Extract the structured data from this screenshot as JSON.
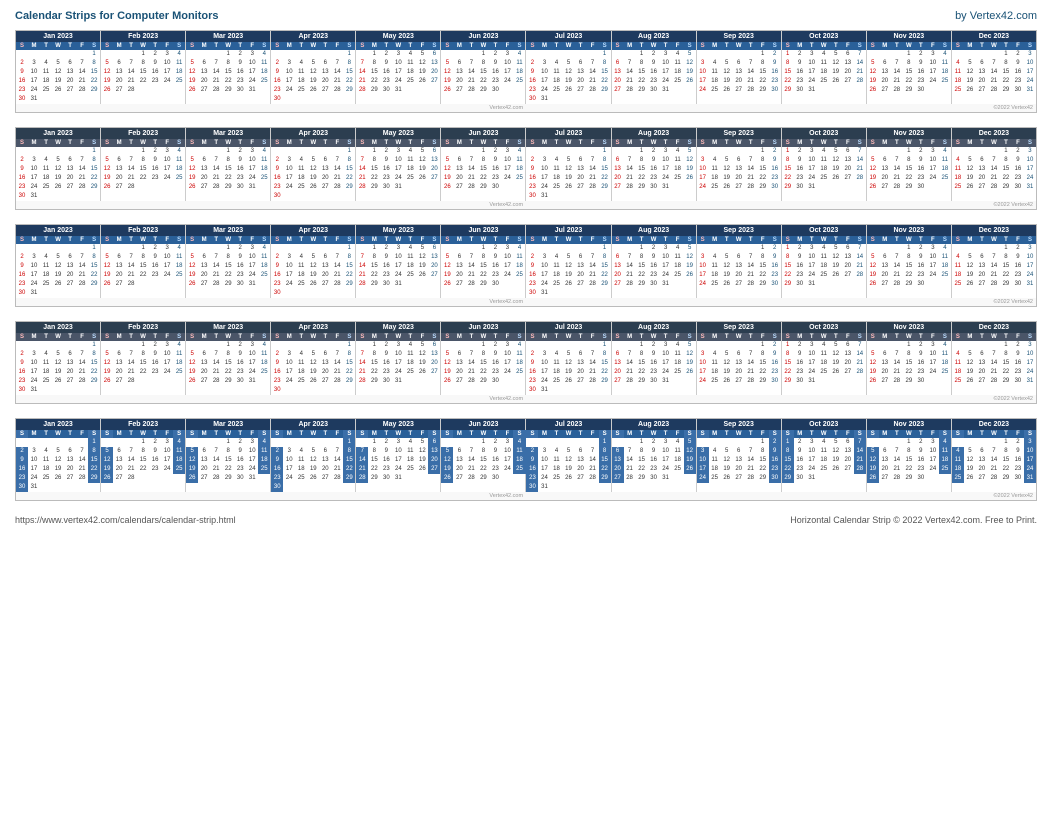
{
  "header": {
    "title": "Calendar Strips for Computer Monitors",
    "brand": "by Vertex42.com"
  },
  "footer": {
    "url": "https://www.vertex42.com/calendars/calendar-strip.html",
    "copyright": "Horizontal Calendar Strip © 2022 Vertex42.com. Free to Print."
  },
  "year": "2023",
  "months": [
    {
      "name": "Jan 2023",
      "weeks": [
        [
          "",
          "",
          "",
          "",
          "",
          "",
          "1"
        ],
        [
          "2",
          "3",
          "4",
          "5",
          "6",
          "7",
          "8"
        ],
        [
          "9",
          "10",
          "11",
          "12",
          "13",
          "14",
          "15"
        ],
        [
          "16",
          "17",
          "18",
          "19",
          "20",
          "21",
          "22"
        ],
        [
          "23",
          "24",
          "25",
          "26",
          "27",
          "28",
          "29"
        ],
        [
          "30",
          "31",
          "",
          "",
          "",
          "",
          ""
        ]
      ]
    },
    {
      "name": "Feb 2023",
      "weeks": [
        [
          "",
          "",
          "",
          "1",
          "2",
          "3",
          "4"
        ],
        [
          "5",
          "6",
          "7",
          "8",
          "9",
          "10",
          "11"
        ],
        [
          "12",
          "13",
          "14",
          "15",
          "16",
          "17",
          "18"
        ],
        [
          "19",
          "20",
          "21",
          "22",
          "23",
          "24",
          "25"
        ],
        [
          "26",
          "27",
          "28",
          "",
          "",
          "",
          ""
        ],
        [
          "",
          "",
          "",
          "",
          "",
          "",
          ""
        ]
      ]
    },
    {
      "name": "Mar 2023",
      "weeks": [
        [
          "",
          "",
          "",
          "1",
          "2",
          "3",
          "4"
        ],
        [
          "5",
          "6",
          "7",
          "8",
          "9",
          "10",
          "11"
        ],
        [
          "12",
          "13",
          "14",
          "15",
          "16",
          "17",
          "18"
        ],
        [
          "19",
          "20",
          "21",
          "22",
          "23",
          "24",
          "25"
        ],
        [
          "26",
          "27",
          "28",
          "29",
          "30",
          "31",
          ""
        ],
        [
          "",
          "",
          "",
          "",
          "",
          "",
          ""
        ]
      ]
    },
    {
      "name": "Apr 2023",
      "weeks": [
        [
          "",
          "",
          "",
          "",
          "",
          "",
          "1"
        ],
        [
          "2",
          "3",
          "4",
          "5",
          "6",
          "7",
          "8"
        ],
        [
          "9",
          "10",
          "11",
          "12",
          "13",
          "14",
          "15"
        ],
        [
          "16",
          "17",
          "18",
          "19",
          "20",
          "21",
          "22"
        ],
        [
          "23",
          "24",
          "25",
          "26",
          "27",
          "28",
          "29"
        ],
        [
          "30",
          "",
          "",
          "",
          "",
          "",
          ""
        ]
      ]
    },
    {
      "name": "May 2023",
      "weeks": [
        [
          "",
          "1",
          "2",
          "3",
          "4",
          "5",
          "6"
        ],
        [
          "7",
          "8",
          "9",
          "10",
          "11",
          "12",
          "13"
        ],
        [
          "14",
          "15",
          "16",
          "17",
          "18",
          "19",
          "20"
        ],
        [
          "21",
          "22",
          "23",
          "24",
          "25",
          "26",
          "27"
        ],
        [
          "28",
          "29",
          "30",
          "31",
          "",
          "",
          ""
        ],
        [
          "",
          "",
          "",
          "",
          "",
          "",
          ""
        ]
      ]
    },
    {
      "name": "Jun 2023",
      "weeks": [
        [
          "",
          "",
          "",
          "1",
          "2",
          "3",
          "4"
        ],
        [
          "5",
          "6",
          "7",
          "8",
          "9",
          "10",
          "11"
        ],
        [
          "12",
          "13",
          "14",
          "15",
          "16",
          "17",
          "18"
        ],
        [
          "19",
          "20",
          "21",
          "22",
          "23",
          "24",
          "25"
        ],
        [
          "26",
          "27",
          "28",
          "29",
          "30",
          "",
          ""
        ],
        [
          "",
          "",
          "",
          "",
          "",
          "",
          ""
        ]
      ]
    },
    {
      "name": "Jul 2023",
      "weeks": [
        [
          "",
          "",
          "",
          "",
          "",
          "",
          "1"
        ],
        [
          "2",
          "3",
          "4",
          "5",
          "6",
          "7",
          "8"
        ],
        [
          "9",
          "10",
          "11",
          "12",
          "13",
          "14",
          "15"
        ],
        [
          "16",
          "17",
          "18",
          "19",
          "20",
          "21",
          "22"
        ],
        [
          "23",
          "24",
          "25",
          "26",
          "27",
          "28",
          "29"
        ],
        [
          "30",
          "31",
          "",
          "",
          "",
          "",
          ""
        ]
      ]
    },
    {
      "name": "Aug 2023",
      "weeks": [
        [
          "",
          "",
          "1",
          "2",
          "3",
          "4",
          "5"
        ],
        [
          "6",
          "7",
          "8",
          "9",
          "10",
          "11",
          "12"
        ],
        [
          "13",
          "14",
          "15",
          "16",
          "17",
          "18",
          "19"
        ],
        [
          "20",
          "21",
          "22",
          "23",
          "24",
          "25",
          "26"
        ],
        [
          "27",
          "28",
          "29",
          "30",
          "31",
          "",
          ""
        ],
        [
          "",
          "",
          "",
          "",
          "",
          "",
          ""
        ]
      ]
    },
    {
      "name": "Sep 2023",
      "weeks": [
        [
          "",
          "",
          "",
          "",
          "",
          "1",
          "2"
        ],
        [
          "3",
          "4",
          "5",
          "6",
          "7",
          "8",
          "9"
        ],
        [
          "10",
          "11",
          "12",
          "13",
          "14",
          "15",
          "16"
        ],
        [
          "17",
          "18",
          "19",
          "20",
          "21",
          "22",
          "23"
        ],
        [
          "24",
          "25",
          "26",
          "27",
          "28",
          "29",
          "30"
        ],
        [
          "",
          "",
          "",
          "",
          "",
          "",
          ""
        ]
      ]
    },
    {
      "name": "Oct 2023",
      "weeks": [
        [
          "1",
          "2",
          "3",
          "4",
          "5",
          "6",
          "7"
        ],
        [
          "8",
          "9",
          "10",
          "11",
          "12",
          "13",
          "14"
        ],
        [
          "15",
          "16",
          "17",
          "18",
          "19",
          "20",
          "21"
        ],
        [
          "22",
          "23",
          "24",
          "25",
          "26",
          "27",
          "28"
        ],
        [
          "29",
          "30",
          "31",
          "",
          "",
          "",
          ""
        ],
        [
          "",
          "",
          "",
          "",
          "",
          "",
          ""
        ]
      ]
    },
    {
      "name": "Nov 2023",
      "weeks": [
        [
          "",
          "",
          "",
          "1",
          "2",
          "3",
          "4"
        ],
        [
          "5",
          "6",
          "7",
          "8",
          "9",
          "10",
          "11"
        ],
        [
          "12",
          "13",
          "14",
          "15",
          "16",
          "17",
          "18"
        ],
        [
          "19",
          "20",
          "21",
          "22",
          "23",
          "24",
          "25"
        ],
        [
          "26",
          "27",
          "28",
          "29",
          "30",
          "",
          ""
        ],
        [
          "",
          "",
          "",
          "",
          "",
          "",
          ""
        ]
      ]
    },
    {
      "name": "Dec 2023",
      "weeks": [
        [
          "",
          "",
          "",
          "",
          "1",
          "2",
          "3"
        ],
        [
          "4",
          "5",
          "6",
          "7",
          "8",
          "9",
          "10"
        ],
        [
          "11",
          "12",
          "13",
          "14",
          "15",
          "16",
          "17"
        ],
        [
          "18",
          "19",
          "20",
          "21",
          "22",
          "23",
          "24"
        ],
        [
          "25",
          "26",
          "27",
          "28",
          "29",
          "30",
          "31"
        ],
        [
          "",
          "",
          "",
          "",
          "",
          "",
          ""
        ]
      ]
    }
  ],
  "dow": [
    "S",
    "M",
    "T",
    "W",
    "T",
    "F",
    "S"
  ]
}
